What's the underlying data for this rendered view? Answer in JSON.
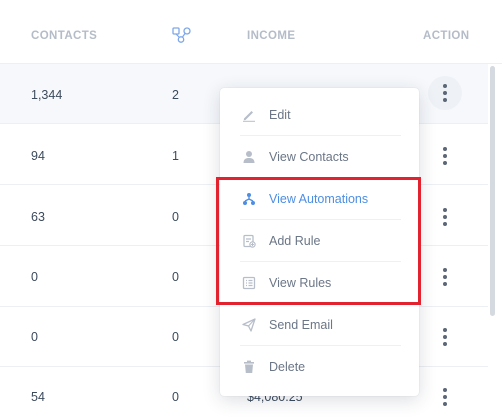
{
  "header": {
    "contacts": "CONTACTS",
    "flow_icon": "flow-nodes-icon",
    "income": "INCOME",
    "action": "ACTION"
  },
  "rows": [
    {
      "contacts": "1,344",
      "flows": "2",
      "income": ""
    },
    {
      "contacts": "94",
      "flows": "1",
      "income": ""
    },
    {
      "contacts": "63",
      "flows": "0",
      "income": ""
    },
    {
      "contacts": "0",
      "flows": "0",
      "income": ""
    },
    {
      "contacts": "0",
      "flows": "0",
      "income": ""
    },
    {
      "contacts": "54",
      "flows": "0",
      "income": "$4,080.25"
    }
  ],
  "menu": {
    "items": [
      {
        "label": "Edit",
        "icon": "pencil-icon"
      },
      {
        "label": "View Contacts",
        "icon": "user-icon"
      },
      {
        "label": "View Automations",
        "icon": "automation-icon"
      },
      {
        "label": "Add Rule",
        "icon": "add-rule-icon"
      },
      {
        "label": "View Rules",
        "icon": "list-icon"
      },
      {
        "label": "Send Email",
        "icon": "paper-plane-icon"
      },
      {
        "label": "Delete",
        "icon": "trash-icon"
      }
    ]
  },
  "colors": {
    "highlight_text": "#4d8ee3",
    "annotation_box": "#e2222f",
    "header_text": "#b4bcc8"
  }
}
